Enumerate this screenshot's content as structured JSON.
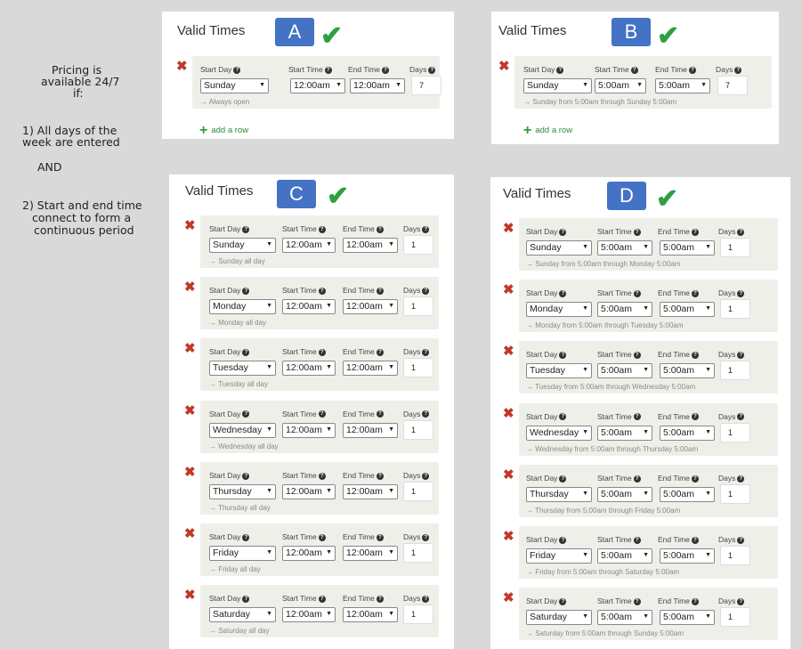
{
  "notes": {
    "line1": "Pricing is",
    "line2": "available 24/7",
    "line3": "if:",
    "line4": "1) All days of the",
    "line5": "week are entered",
    "and": "AND",
    "line6": "2) Start and end time",
    "line7": "connect to form a",
    "line8": "continuous period"
  },
  "labels": {
    "start_day": "Start Day",
    "start_time": "Start Time",
    "end_time": "End Time",
    "days": "Days",
    "help": "?"
  },
  "panels": {
    "a": {
      "title": "Valid Times",
      "letter": "A",
      "check": "✔",
      "rows": [
        {
          "day": "Sunday",
          "start": "12:00am",
          "end": "12:00am",
          "days": "7",
          "desc": "→ Always open"
        }
      ],
      "add": "add a row"
    },
    "b": {
      "title": "Valid Times",
      "letter": "B",
      "check": "✔",
      "rows": [
        {
          "day": "Sunday",
          "start": "5:00am",
          "end": "5:00am",
          "days": "7",
          "desc": "→ Sunday from 5:00am through Sunday 5:00am"
        }
      ],
      "add": "add a row"
    },
    "c": {
      "title": "Valid Times",
      "letter": "C",
      "check": "✔",
      "rows": [
        {
          "day": "Sunday",
          "start": "12:00am",
          "end": "12:00am",
          "days": "1",
          "desc": "→ Sunday all day"
        },
        {
          "day": "Monday",
          "start": "12:00am",
          "end": "12:00am",
          "days": "1",
          "desc": "→ Monday all day"
        },
        {
          "day": "Tuesday",
          "start": "12:00am",
          "end": "12:00am",
          "days": "1",
          "desc": "→ Tuesday all day"
        },
        {
          "day": "Wednesday",
          "start": "12:00am",
          "end": "12:00am",
          "days": "1",
          "desc": "→ Wednesday all day"
        },
        {
          "day": "Thursday",
          "start": "12:00am",
          "end": "12:00am",
          "days": "1",
          "desc": "→ Thursday all day"
        },
        {
          "day": "Friday",
          "start": "12:00am",
          "end": "12:00am",
          "days": "1",
          "desc": "→ Friday all day"
        },
        {
          "day": "Saturday",
          "start": "12:00am",
          "end": "12:00am",
          "days": "1",
          "desc": "→ Saturday all day"
        }
      ]
    },
    "d": {
      "title": "Valid Times",
      "letter": "D",
      "check": "✔",
      "rows": [
        {
          "day": "Sunday",
          "start": "5:00am",
          "end": "5:00am",
          "days": "1",
          "desc": "→ Sunday from 5:00am through Monday 5:00am"
        },
        {
          "day": "Monday",
          "start": "5:00am",
          "end": "5:00am",
          "days": "1",
          "desc": "→ Monday from 5:00am through Tuesday 5:00am"
        },
        {
          "day": "Tuesday",
          "start": "5:00am",
          "end": "5:00am",
          "days": "1",
          "desc": "→ Tuesday from 5:00am through Wednesday 5:00am"
        },
        {
          "day": "Wednesday",
          "start": "5:00am",
          "end": "5:00am",
          "days": "1",
          "desc": "→ Wednesday from 5:00am through Thursday 5:00am"
        },
        {
          "day": "Thursday",
          "start": "5:00am",
          "end": "5:00am",
          "days": "1",
          "desc": "→ Thursday from 5:00am through Friday 5:00am"
        },
        {
          "day": "Friday",
          "start": "5:00am",
          "end": "5:00am",
          "days": "1",
          "desc": "→ Friday from 5:00am through Saturday 5:00am"
        },
        {
          "day": "Saturday",
          "start": "5:00am",
          "end": "5:00am",
          "days": "1",
          "desc": "→ Saturday from 5:00am through Sunday 5:00am"
        }
      ]
    }
  },
  "colors": {
    "letter_bg": "#4472c4",
    "check": "#2ea043",
    "delete": "#c0392b",
    "row_bg": "#efefea",
    "add": "#2e8b3a"
  }
}
